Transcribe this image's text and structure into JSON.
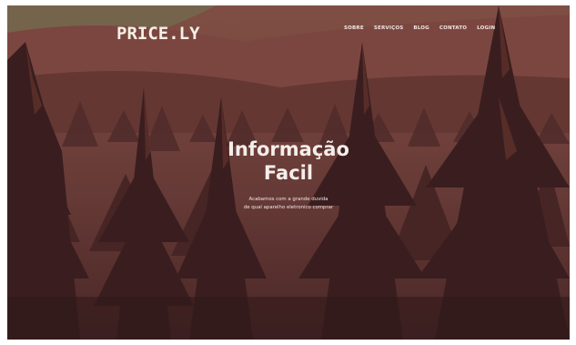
{
  "brand": {
    "logo_text": "PRICE.LY"
  },
  "nav": {
    "items": [
      {
        "label": "SOBRE"
      },
      {
        "label": "SERVIÇOS"
      },
      {
        "label": "BLOG"
      },
      {
        "label": "CONTATO"
      },
      {
        "label": "LOGIN"
      }
    ]
  },
  "hero": {
    "title_line1": "Informação",
    "title_line2": "Facil",
    "subtitle_line1": "Acabamos com a grande duvida",
    "subtitle_line2": "de qual aparelho eletronico comprar"
  },
  "background": {
    "description_icon": "forest-illustration",
    "sky_color": "#c08a7a",
    "hill_color": "#8a4e45",
    "forest_color": "#4e2b29",
    "tree_dark": "#3a1f20",
    "tree_light": "#7a3f35"
  }
}
